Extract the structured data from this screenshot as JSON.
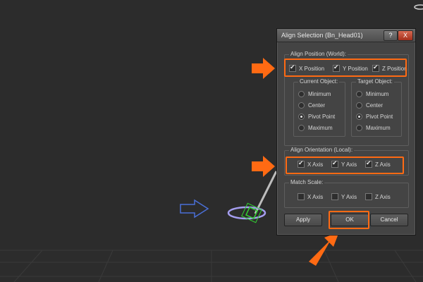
{
  "dialog": {
    "title": "Align Selection (Bn_Head01)",
    "help_label": "?",
    "close_label": "X"
  },
  "align_position": {
    "label": "Align Position (World):",
    "x": {
      "label": "X Position",
      "checked": true
    },
    "y": {
      "label": "Y Position",
      "checked": true
    },
    "z": {
      "label": "Z Position",
      "checked": true
    }
  },
  "current_object": {
    "label": "Current Object:",
    "options": [
      "Minimum",
      "Center",
      "Pivot Point",
      "Maximum"
    ],
    "selected": "Pivot Point"
  },
  "target_object": {
    "label": "Target Object:",
    "options": [
      "Minimum",
      "Center",
      "Pivot Point",
      "Maximum"
    ],
    "selected": "Pivot Point"
  },
  "align_orientation": {
    "label": "Align Orientation (Local):",
    "x": {
      "label": "X Axis",
      "checked": true
    },
    "y": {
      "label": "Y Axis",
      "checked": true
    },
    "z": {
      "label": "Z Axis",
      "checked": true
    }
  },
  "match_scale": {
    "label": "Match Scale:",
    "x": {
      "label": "X Axis",
      "checked": false
    },
    "y": {
      "label": "Y Axis",
      "checked": false
    },
    "z": {
      "label": "Z Axis",
      "checked": false
    }
  },
  "buttons": {
    "apply": "Apply",
    "ok": "OK",
    "cancel": "Cancel"
  },
  "colors": {
    "highlight": "#ff6a13",
    "arrow": "#ff6a13"
  }
}
